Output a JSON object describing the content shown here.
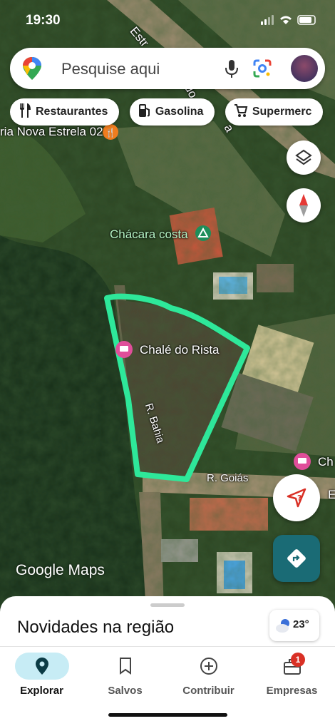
{
  "status_bar": {
    "time": "19:30"
  },
  "search": {
    "placeholder": "Pesquise aqui"
  },
  "chips": [
    {
      "label": "Restaurantes",
      "icon": "restaurant-icon"
    },
    {
      "label": "Gasolina",
      "icon": "gas-station-icon"
    },
    {
      "label": "Supermerc",
      "icon": "cart-icon"
    }
  ],
  "map": {
    "labels": {
      "road_top": "Estr",
      "road_top2": "do",
      "road_top3": "a",
      "place_top": "ria Nova Estrela 02",
      "chacara": "Chácara costa",
      "chale": "Chalé do Rista",
      "rua_bahia": "R. Bahia",
      "rua_goias": "R. Goiás",
      "right_place": "Ch",
      "right_place2": "E"
    },
    "attribution": "Google Maps",
    "boundary_color": "#2ee89a"
  },
  "bottom_sheet": {
    "title": "Novidades na região",
    "temperature": "23°"
  },
  "nav": {
    "items": [
      {
        "label": "Explorar",
        "icon": "explore-pin-icon",
        "active": true
      },
      {
        "label": "Salvos",
        "icon": "bookmark-icon"
      },
      {
        "label": "Contribuir",
        "icon": "add-circle-icon"
      },
      {
        "label": "Empresas",
        "icon": "business-icon",
        "badge": "1"
      }
    ]
  },
  "colors": {
    "accent": "#1a6b75",
    "active_pill": "#c7ecf5",
    "badge": "#d93025"
  }
}
